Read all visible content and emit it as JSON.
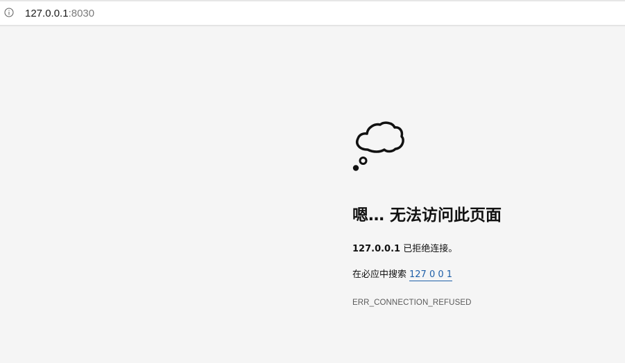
{
  "address_bar": {
    "icon": "info-icon",
    "url_host": "127.0.0.1",
    "url_port": ":8030"
  },
  "error_page": {
    "icon": "thought-cloud-icon",
    "heading": "嗯… 无法访问此页面",
    "refused_host": "127.0.0.1",
    "refused_message": " 已拒绝连接。",
    "search_prefix": "在必应中搜索",
    "search_link": "127 0 0 1",
    "error_code": "ERR_CONNECTION_REFUSED"
  },
  "colors": {
    "background": "#f5f5f5",
    "link": "#1f5fa8",
    "error_code": "#5a5a5a"
  }
}
